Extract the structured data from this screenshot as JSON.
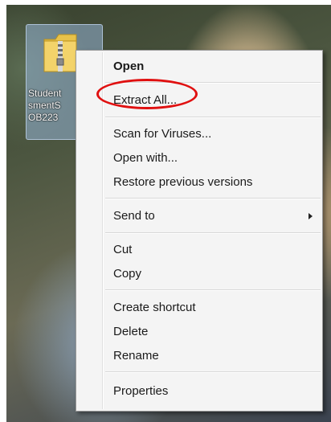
{
  "desktop": {
    "file_icon": {
      "label": "Student\nsmentS\nOB223",
      "icon": "zip-folder-icon"
    }
  },
  "context_menu": {
    "items": [
      {
        "label": "Open",
        "bold": true
      },
      {
        "label": "Extract All..."
      },
      {
        "label": "Scan for Viruses..."
      },
      {
        "label": "Open with..."
      },
      {
        "label": "Restore previous versions"
      },
      {
        "label": "Send to",
        "submenu": true
      },
      {
        "label": "Cut"
      },
      {
        "label": "Copy"
      },
      {
        "label": "Create shortcut"
      },
      {
        "label": "Delete"
      },
      {
        "label": "Rename"
      },
      {
        "label": "Properties"
      }
    ]
  },
  "annotation": {
    "highlight_color": "#e01010",
    "target_item": "Extract All..."
  }
}
